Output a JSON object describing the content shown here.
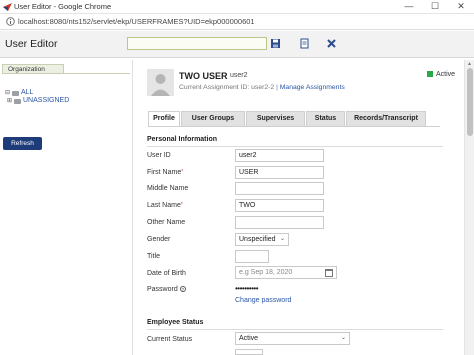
{
  "window": {
    "title": "User Editor - Google Chrome",
    "url": "localhost:8080/nts152/servlet/ekp/USERFRAMES?UID=ekp000000601"
  },
  "header": {
    "title": "User Editor",
    "search_value": ""
  },
  "left": {
    "org_tab": "Organization",
    "tree": [
      {
        "label": "ALL",
        "expander": "⊟"
      },
      {
        "label": "UNASSIGNED",
        "expander": "⊞"
      }
    ],
    "refresh_label": "Refresh"
  },
  "user": {
    "name": "TWO USER",
    "id": "user2",
    "assignment_prefix": "Current Assignment ID: user2-2 |",
    "assignment_link": "Manage Assignments",
    "status": "Active",
    "status_color": "#2aa84a"
  },
  "tabs": [
    "Profile",
    "User Groups",
    "Supervises",
    "Status",
    "Records/Transcript"
  ],
  "personal": {
    "section": "Personal Information",
    "user_id": {
      "label": "User ID",
      "value": "user2"
    },
    "first_name": {
      "label": "First Name",
      "value": "USER"
    },
    "middle_name": {
      "label": "Middle Name",
      "value": ""
    },
    "last_name": {
      "label": "Last Name",
      "value": "TWO"
    },
    "other_name": {
      "label": "Other Name",
      "value": ""
    },
    "gender": {
      "label": "Gender",
      "value": "Unspecified"
    },
    "title": {
      "label": "Title",
      "value": ""
    },
    "dob": {
      "label": "Date of Birth",
      "placeholder": "e.g Sep 18, 2020"
    },
    "password": {
      "label": "Password",
      "value": "••••••••••",
      "change_link": "Change password"
    }
  },
  "employee": {
    "section": "Employee Status",
    "current_status": {
      "label": "Current Status",
      "value": "Active"
    }
  }
}
